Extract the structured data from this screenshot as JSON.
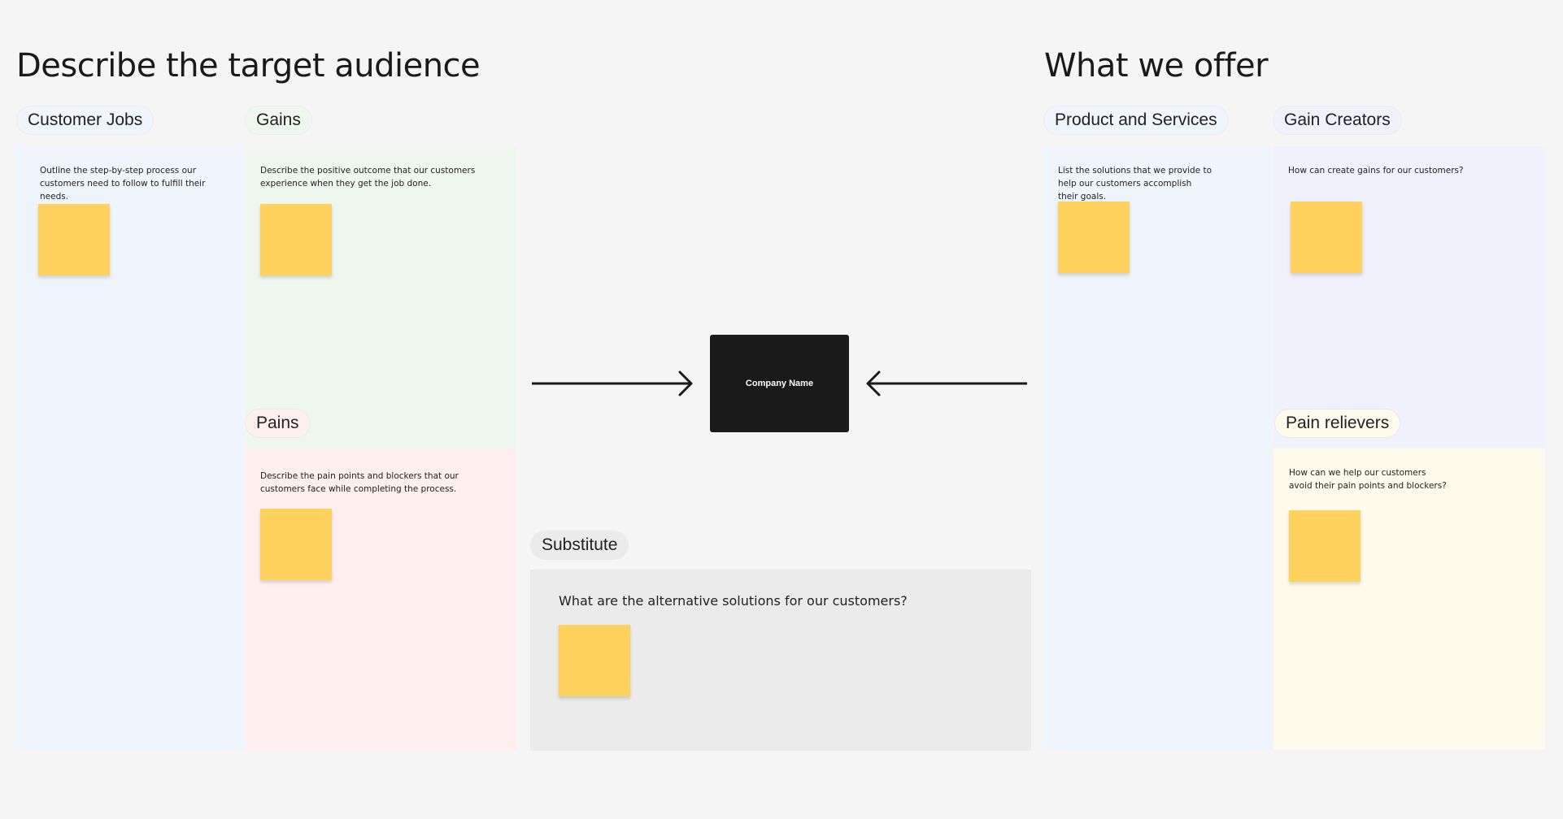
{
  "headings": {
    "left": "Describe the target audience",
    "right": "What we offer"
  },
  "sections": {
    "customer_jobs": {
      "label": "Customer Jobs",
      "description": "Outline the step-by-step process our customers need to follow to fulfill their needs.",
      "color": "#eef5fd"
    },
    "gains": {
      "label": "Gains",
      "description": "Describe the positive outcome that our customers experience when they get the job done.",
      "color": "#eef7ee"
    },
    "pains": {
      "label": "Pains",
      "description": "Describe the pain points and blockers that our customers face while completing the process.",
      "color": "#fcefee"
    },
    "substitute": {
      "label": "Substitute",
      "description": "What are the alternative solutions for our customers?",
      "color": "#ebebeb"
    },
    "product_services": {
      "label": "Product and Services",
      "description": "List the solutions that we provide to help our customers accomplish their goals.",
      "color": "#eef5fd"
    },
    "gain_creators": {
      "label": "Gain Creators",
      "description": "How can create gains for our customers?",
      "color": "#f1f0fd"
    },
    "pain_relievers": {
      "label": "Pain relievers",
      "description": "How can we help our customers avoid their pain points and blockers?",
      "color": "#fefbec"
    }
  },
  "center": {
    "company_name": "Company Name"
  },
  "colors": {
    "sticky_note": "#ffd25e",
    "company_box": "#1a1a1a",
    "arrow": "#1a1a1a",
    "background": "#f5f5f5"
  }
}
